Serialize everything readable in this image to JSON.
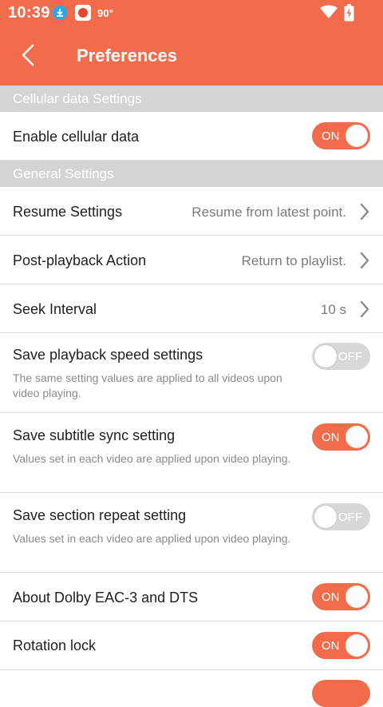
{
  "status_bar": {
    "time": "10:39",
    "temperature": "90°",
    "icons": [
      "download-icon",
      "app-notification-icon",
      "wifi-icon",
      "battery-charging-icon"
    ]
  },
  "app_bar": {
    "title": "Preferences",
    "back_icon": "chevron-left-icon"
  },
  "sections": {
    "cellular": "Cellular data Settings",
    "general": "General Settings"
  },
  "settings": {
    "cellular_data": {
      "label": "Enable cellular data",
      "toggle": "ON"
    },
    "resume": {
      "label": "Resume Settings",
      "value": "Resume from latest point."
    },
    "post_playback": {
      "label": "Post-playback Action",
      "value": "Return to playlist."
    },
    "seek_interval": {
      "label": "Seek Interval",
      "value": "10 s"
    },
    "save_speed": {
      "label": "Save playback speed settings",
      "description": "The same setting values are applied to all videos upon video playing.",
      "toggle": "OFF"
    },
    "save_subtitle": {
      "label": "Save subtitle sync setting",
      "description": "Values set in each video are applied upon video playing.",
      "toggle": "ON"
    },
    "save_repeat": {
      "label": "Save section repeat setting",
      "description": "Values set in each video are applied upon video playing.",
      "toggle": "OFF"
    },
    "dolby": {
      "label": "About Dolby EAC-3 and DTS",
      "toggle": "ON"
    },
    "rotation_lock": {
      "label": "Rotation lock",
      "toggle": "ON"
    }
  },
  "colors": {
    "accent": "#f26b4a",
    "section_bg": "#d4d4d4",
    "toggle_off": "#d8d8d8"
  }
}
